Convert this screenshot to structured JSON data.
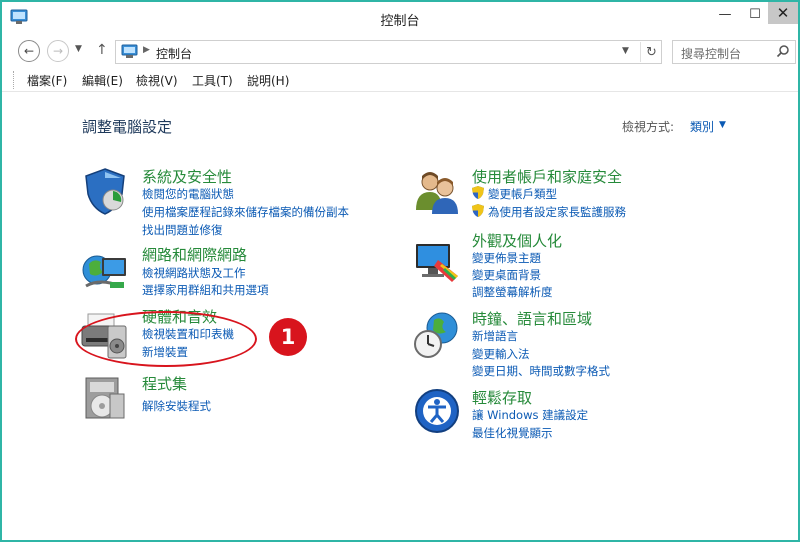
{
  "window": {
    "title": "控制台"
  },
  "titlebar": {
    "minimize": "—",
    "maximize": "☐",
    "close": "✕"
  },
  "address": {
    "path": "控制台",
    "search_placeholder": "搜尋控制台"
  },
  "menu": [
    "檔案(F)",
    "編輯(E)",
    "檢視(V)",
    "工具(T)",
    "說明(H)"
  ],
  "page": {
    "title": "調整電腦設定",
    "view_by_label": "檢視方式:",
    "view_by_value": "類別"
  },
  "categories": {
    "system": {
      "title": "系統及安全性",
      "icon": "shield-icon",
      "links": [
        "檢閱您的電腦狀態",
        "使用檔案歷程記錄來儲存檔案的備份副本",
        "找出問題並修復"
      ]
    },
    "network": {
      "title": "網路和網際網路",
      "icon": "network-globe-icon",
      "links": [
        "檢視網路狀態及工作",
        "選擇家用群組和共用選項"
      ]
    },
    "hardware": {
      "title": "硬體和音效",
      "icon": "printer-speaker-icon",
      "links": [
        "檢視裝置和印表機",
        "新增裝置"
      ]
    },
    "programs": {
      "title": "程式集",
      "icon": "programs-disc-icon",
      "links": [
        "解除安裝程式"
      ]
    },
    "users": {
      "title": "使用者帳戶和家庭安全",
      "icon": "users-icon",
      "links": [
        "變更帳戶類型",
        "為使用者設定家長監護服務"
      ]
    },
    "appearance": {
      "title": "外觀及個人化",
      "icon": "monitor-palette-icon",
      "links": [
        "變更佈景主題",
        "變更桌面背景",
        "調整螢幕解析度"
      ]
    },
    "clock": {
      "title": "時鐘、語言和區域",
      "icon": "clock-globe-icon",
      "links": [
        "新增語言",
        "變更輸入法",
        "變更日期、時間或數字格式"
      ]
    },
    "ease": {
      "title": "輕鬆存取",
      "icon": "ease-of-access-icon",
      "links": [
        "讓 Windows 建議設定",
        "最佳化視覺顯示"
      ]
    }
  },
  "annotation": {
    "number": "1"
  },
  "colors": {
    "window_border": "#2fb5a6",
    "category_title": "#268a3a",
    "link": "#0b5ab4",
    "annotation": "#d8141d"
  }
}
